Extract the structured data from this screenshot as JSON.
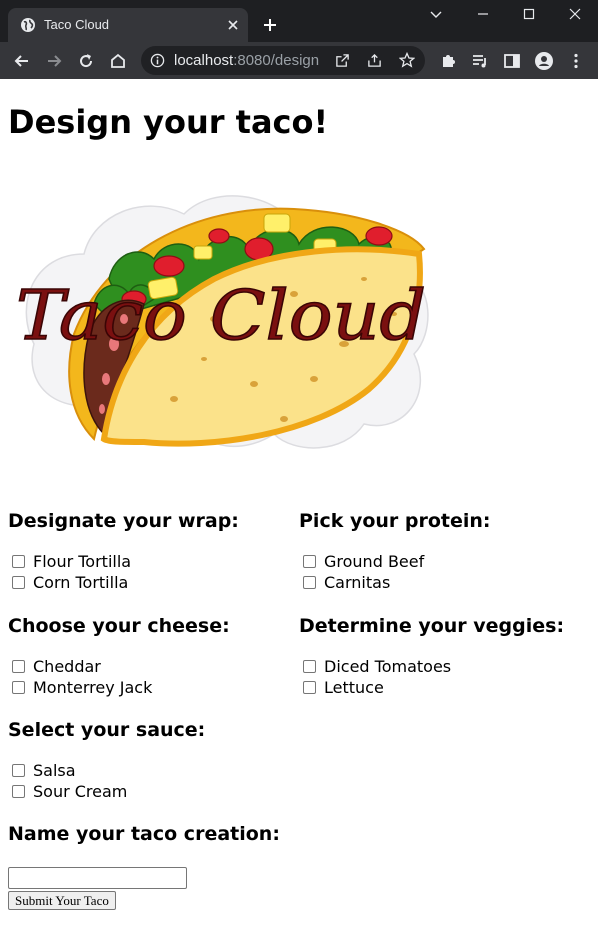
{
  "browser": {
    "tab_title": "Taco Cloud",
    "url_host": "localhost",
    "url_rest": ":8080/design"
  },
  "page": {
    "heading": "Design your taco!",
    "logo_text": "Taco Cloud",
    "wrap": {
      "heading": "Designate your wrap:",
      "options": [
        "Flour Tortilla",
        "Corn Tortilla"
      ]
    },
    "protein": {
      "heading": "Pick your protein:",
      "options": [
        "Ground Beef",
        "Carnitas"
      ]
    },
    "cheese": {
      "heading": "Choose your cheese:",
      "options": [
        "Cheddar",
        "Monterrey Jack"
      ]
    },
    "veggies": {
      "heading": "Determine your veggies:",
      "options": [
        "Diced Tomatoes",
        "Lettuce"
      ]
    },
    "sauce": {
      "heading": "Select your sauce:",
      "options": [
        "Salsa",
        "Sour Cream"
      ]
    },
    "name": {
      "heading": "Name your taco creation:",
      "value": ""
    },
    "submit_label": "Submit Your Taco"
  },
  "colors": {
    "chrome_dark": "#1e1f22",
    "chrome_toolbar": "#35363a",
    "omnibox": "#202124",
    "logo_text": "#7a1010"
  }
}
